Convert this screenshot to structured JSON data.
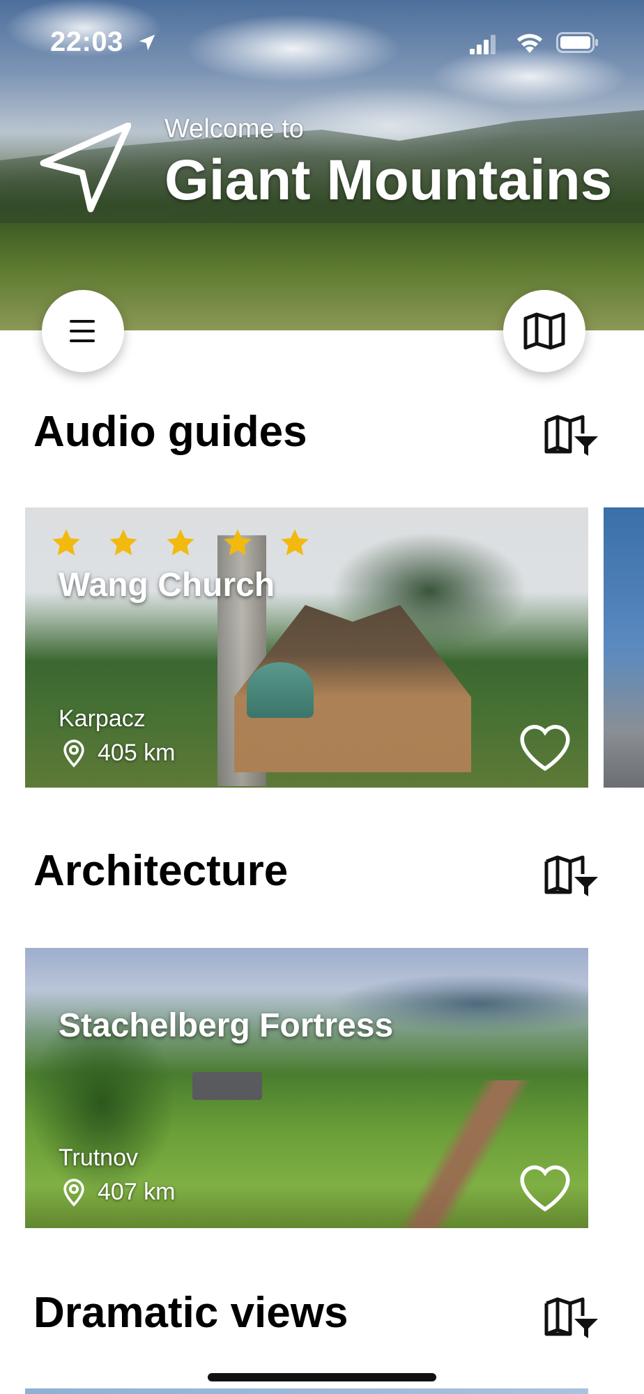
{
  "status_bar": {
    "time": "22:03",
    "icons": [
      "location-arrow-icon",
      "signal-icon",
      "wifi-icon",
      "battery-icon"
    ]
  },
  "header": {
    "welcome": "Welcome to",
    "title": "Giant Mountains",
    "icons": [
      "navigation-arrow-icon",
      "menu-icon",
      "map-icon"
    ]
  },
  "sections": [
    {
      "title": "Audio guides",
      "filter_icon": "map-filter-icon",
      "card": {
        "title": "Wang Church",
        "city": "Karpacz",
        "distance": "405 km",
        "rating": 5
      }
    },
    {
      "title": "Architecture",
      "filter_icon": "map-filter-icon",
      "card": {
        "title": "Stachelberg Fortress",
        "city": "Trutnov",
        "distance": "407 km"
      }
    },
    {
      "title": "Dramatic views",
      "filter_icon": "map-filter-icon"
    }
  ],
  "colors": {
    "star": "#F2B90F",
    "text_dark": "#000000",
    "white": "#FFFFFF"
  }
}
